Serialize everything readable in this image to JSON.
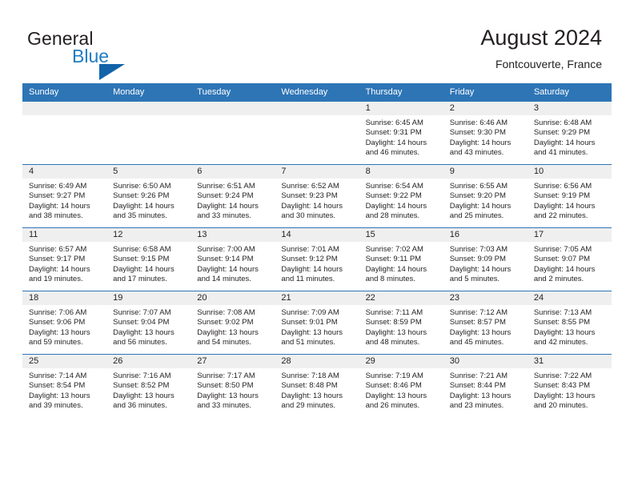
{
  "brand": {
    "name_part1": "General",
    "name_part2": "Blue",
    "logo_icon": "triangle-icon"
  },
  "header": {
    "title": "August 2024",
    "subtitle": "Fontcouverte, France"
  },
  "colors": {
    "header_blue": "#2e75b6",
    "brand_blue": "#1f7dc4",
    "logo_blue": "#1263a8",
    "day_strip_gray": "#efefef",
    "text": "#231f20"
  },
  "weekday_headers": [
    "Sunday",
    "Monday",
    "Tuesday",
    "Wednesday",
    "Thursday",
    "Friday",
    "Saturday"
  ],
  "weeks": [
    [
      {
        "empty": true
      },
      {
        "empty": true
      },
      {
        "empty": true
      },
      {
        "empty": true
      },
      {
        "day": "1",
        "sunrise": "Sunrise: 6:45 AM",
        "sunset": "Sunset: 9:31 PM",
        "daylight1": "Daylight: 14 hours",
        "daylight2": "and 46 minutes."
      },
      {
        "day": "2",
        "sunrise": "Sunrise: 6:46 AM",
        "sunset": "Sunset: 9:30 PM",
        "daylight1": "Daylight: 14 hours",
        "daylight2": "and 43 minutes."
      },
      {
        "day": "3",
        "sunrise": "Sunrise: 6:48 AM",
        "sunset": "Sunset: 9:29 PM",
        "daylight1": "Daylight: 14 hours",
        "daylight2": "and 41 minutes."
      }
    ],
    [
      {
        "day": "4",
        "sunrise": "Sunrise: 6:49 AM",
        "sunset": "Sunset: 9:27 PM",
        "daylight1": "Daylight: 14 hours",
        "daylight2": "and 38 minutes."
      },
      {
        "day": "5",
        "sunrise": "Sunrise: 6:50 AM",
        "sunset": "Sunset: 9:26 PM",
        "daylight1": "Daylight: 14 hours",
        "daylight2": "and 35 minutes."
      },
      {
        "day": "6",
        "sunrise": "Sunrise: 6:51 AM",
        "sunset": "Sunset: 9:24 PM",
        "daylight1": "Daylight: 14 hours",
        "daylight2": "and 33 minutes."
      },
      {
        "day": "7",
        "sunrise": "Sunrise: 6:52 AM",
        "sunset": "Sunset: 9:23 PM",
        "daylight1": "Daylight: 14 hours",
        "daylight2": "and 30 minutes."
      },
      {
        "day": "8",
        "sunrise": "Sunrise: 6:54 AM",
        "sunset": "Sunset: 9:22 PM",
        "daylight1": "Daylight: 14 hours",
        "daylight2": "and 28 minutes."
      },
      {
        "day": "9",
        "sunrise": "Sunrise: 6:55 AM",
        "sunset": "Sunset: 9:20 PM",
        "daylight1": "Daylight: 14 hours",
        "daylight2": "and 25 minutes."
      },
      {
        "day": "10",
        "sunrise": "Sunrise: 6:56 AM",
        "sunset": "Sunset: 9:19 PM",
        "daylight1": "Daylight: 14 hours",
        "daylight2": "and 22 minutes."
      }
    ],
    [
      {
        "day": "11",
        "sunrise": "Sunrise: 6:57 AM",
        "sunset": "Sunset: 9:17 PM",
        "daylight1": "Daylight: 14 hours",
        "daylight2": "and 19 minutes."
      },
      {
        "day": "12",
        "sunrise": "Sunrise: 6:58 AM",
        "sunset": "Sunset: 9:15 PM",
        "daylight1": "Daylight: 14 hours",
        "daylight2": "and 17 minutes."
      },
      {
        "day": "13",
        "sunrise": "Sunrise: 7:00 AM",
        "sunset": "Sunset: 9:14 PM",
        "daylight1": "Daylight: 14 hours",
        "daylight2": "and 14 minutes."
      },
      {
        "day": "14",
        "sunrise": "Sunrise: 7:01 AM",
        "sunset": "Sunset: 9:12 PM",
        "daylight1": "Daylight: 14 hours",
        "daylight2": "and 11 minutes."
      },
      {
        "day": "15",
        "sunrise": "Sunrise: 7:02 AM",
        "sunset": "Sunset: 9:11 PM",
        "daylight1": "Daylight: 14 hours",
        "daylight2": "and 8 minutes."
      },
      {
        "day": "16",
        "sunrise": "Sunrise: 7:03 AM",
        "sunset": "Sunset: 9:09 PM",
        "daylight1": "Daylight: 14 hours",
        "daylight2": "and 5 minutes."
      },
      {
        "day": "17",
        "sunrise": "Sunrise: 7:05 AM",
        "sunset": "Sunset: 9:07 PM",
        "daylight1": "Daylight: 14 hours",
        "daylight2": "and 2 minutes."
      }
    ],
    [
      {
        "day": "18",
        "sunrise": "Sunrise: 7:06 AM",
        "sunset": "Sunset: 9:06 PM",
        "daylight1": "Daylight: 13 hours",
        "daylight2": "and 59 minutes."
      },
      {
        "day": "19",
        "sunrise": "Sunrise: 7:07 AM",
        "sunset": "Sunset: 9:04 PM",
        "daylight1": "Daylight: 13 hours",
        "daylight2": "and 56 minutes."
      },
      {
        "day": "20",
        "sunrise": "Sunrise: 7:08 AM",
        "sunset": "Sunset: 9:02 PM",
        "daylight1": "Daylight: 13 hours",
        "daylight2": "and 54 minutes."
      },
      {
        "day": "21",
        "sunrise": "Sunrise: 7:09 AM",
        "sunset": "Sunset: 9:01 PM",
        "daylight1": "Daylight: 13 hours",
        "daylight2": "and 51 minutes."
      },
      {
        "day": "22",
        "sunrise": "Sunrise: 7:11 AM",
        "sunset": "Sunset: 8:59 PM",
        "daylight1": "Daylight: 13 hours",
        "daylight2": "and 48 minutes."
      },
      {
        "day": "23",
        "sunrise": "Sunrise: 7:12 AM",
        "sunset": "Sunset: 8:57 PM",
        "daylight1": "Daylight: 13 hours",
        "daylight2": "and 45 minutes."
      },
      {
        "day": "24",
        "sunrise": "Sunrise: 7:13 AM",
        "sunset": "Sunset: 8:55 PM",
        "daylight1": "Daylight: 13 hours",
        "daylight2": "and 42 minutes."
      }
    ],
    [
      {
        "day": "25",
        "sunrise": "Sunrise: 7:14 AM",
        "sunset": "Sunset: 8:54 PM",
        "daylight1": "Daylight: 13 hours",
        "daylight2": "and 39 minutes."
      },
      {
        "day": "26",
        "sunrise": "Sunrise: 7:16 AM",
        "sunset": "Sunset: 8:52 PM",
        "daylight1": "Daylight: 13 hours",
        "daylight2": "and 36 minutes."
      },
      {
        "day": "27",
        "sunrise": "Sunrise: 7:17 AM",
        "sunset": "Sunset: 8:50 PM",
        "daylight1": "Daylight: 13 hours",
        "daylight2": "and 33 minutes."
      },
      {
        "day": "28",
        "sunrise": "Sunrise: 7:18 AM",
        "sunset": "Sunset: 8:48 PM",
        "daylight1": "Daylight: 13 hours",
        "daylight2": "and 29 minutes."
      },
      {
        "day": "29",
        "sunrise": "Sunrise: 7:19 AM",
        "sunset": "Sunset: 8:46 PM",
        "daylight1": "Daylight: 13 hours",
        "daylight2": "and 26 minutes."
      },
      {
        "day": "30",
        "sunrise": "Sunrise: 7:21 AM",
        "sunset": "Sunset: 8:44 PM",
        "daylight1": "Daylight: 13 hours",
        "daylight2": "and 23 minutes."
      },
      {
        "day": "31",
        "sunrise": "Sunrise: 7:22 AM",
        "sunset": "Sunset: 8:43 PM",
        "daylight1": "Daylight: 13 hours",
        "daylight2": "and 20 minutes."
      }
    ]
  ]
}
